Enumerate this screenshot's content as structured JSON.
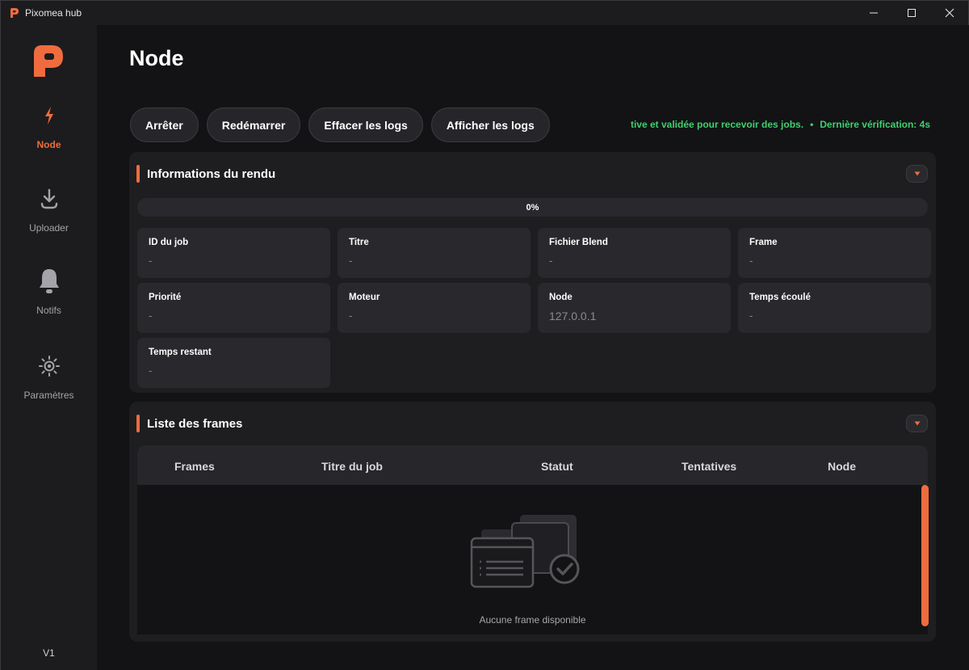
{
  "window": {
    "title": "Pixomea hub"
  },
  "sidebar": {
    "items": [
      {
        "label": "Node",
        "icon": "lightning-icon",
        "active": true
      },
      {
        "label": "Uploader",
        "icon": "download-icon",
        "active": false
      },
      {
        "label": "Notifs",
        "icon": "bell-icon",
        "active": false
      },
      {
        "label": "Paramètres",
        "icon": "gear-icon",
        "active": false
      }
    ],
    "version": "V1"
  },
  "main": {
    "title": "Node",
    "actions": [
      "Arrêter",
      "Redémarrer",
      "Effacer les logs",
      "Afficher les logs"
    ],
    "status": {
      "message": "tive et validée pour recevoir des jobs.",
      "separator": "•",
      "last_check": "Dernière vérification: 4s",
      "color": "#3fcf6f"
    }
  },
  "render_info": {
    "title": "Informations du rendu",
    "progress": "0%",
    "fields": [
      {
        "label": "ID du job",
        "value": "-"
      },
      {
        "label": "Titre",
        "value": "-"
      },
      {
        "label": "Fichier Blend",
        "value": "-"
      },
      {
        "label": "Frame",
        "value": "-"
      },
      {
        "label": "Priorité",
        "value": "-"
      },
      {
        "label": "Moteur",
        "value": "-"
      },
      {
        "label": "Node",
        "value": "127.0.0.1"
      },
      {
        "label": "Temps écoulé",
        "value": "-"
      },
      {
        "label": "Temps restant",
        "value": "-"
      }
    ]
  },
  "frames": {
    "title": "Liste des frames",
    "columns": [
      "Frames",
      "Titre du job",
      "Statut",
      "Tentatives",
      "Node"
    ],
    "empty_text": "Aucune frame disponible"
  },
  "colors": {
    "accent": "#f06c3e",
    "success": "#3fcf6f"
  }
}
